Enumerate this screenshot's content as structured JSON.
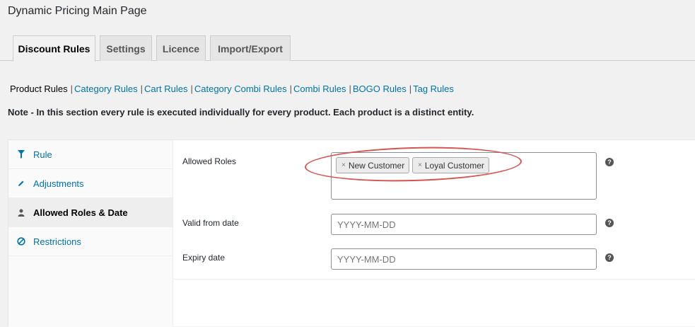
{
  "page": {
    "title": "Dynamic Pricing Main Page"
  },
  "tabs": [
    {
      "label": "Discount Rules",
      "active": true
    },
    {
      "label": "Settings"
    },
    {
      "label": "Licence"
    },
    {
      "label": "Import/Export"
    }
  ],
  "subnav": {
    "current": "Product Rules",
    "links": [
      "Category Rules",
      "Cart Rules",
      "Category Combi Rules",
      "Combi Rules",
      "BOGO Rules",
      "Tag Rules"
    ]
  },
  "note": "Note - In this section every rule is executed individually for every product. Each product is a distinct entity.",
  "sidebar": {
    "items": [
      {
        "label": "Rule",
        "icon": "filter-icon"
      },
      {
        "label": "Adjustments",
        "icon": "pencil-icon"
      },
      {
        "label": "Allowed Roles & Date",
        "icon": "users-icon",
        "active": true
      },
      {
        "label": "Restrictions",
        "icon": "ban-icon"
      }
    ]
  },
  "form": {
    "allowed_roles": {
      "label": "Allowed Roles",
      "remove_symbol": "×",
      "selected": [
        "New Customer",
        "Loyal Customer"
      ],
      "help": "?"
    },
    "valid_from": {
      "label": "Valid from date",
      "placeholder": "YYYY-MM-DD",
      "help": "?"
    },
    "expiry": {
      "label": "Expiry date",
      "placeholder": "YYYY-MM-DD",
      "help": "?"
    }
  },
  "colors": {
    "link": "#0073aa",
    "highlight": "#d9534f"
  }
}
